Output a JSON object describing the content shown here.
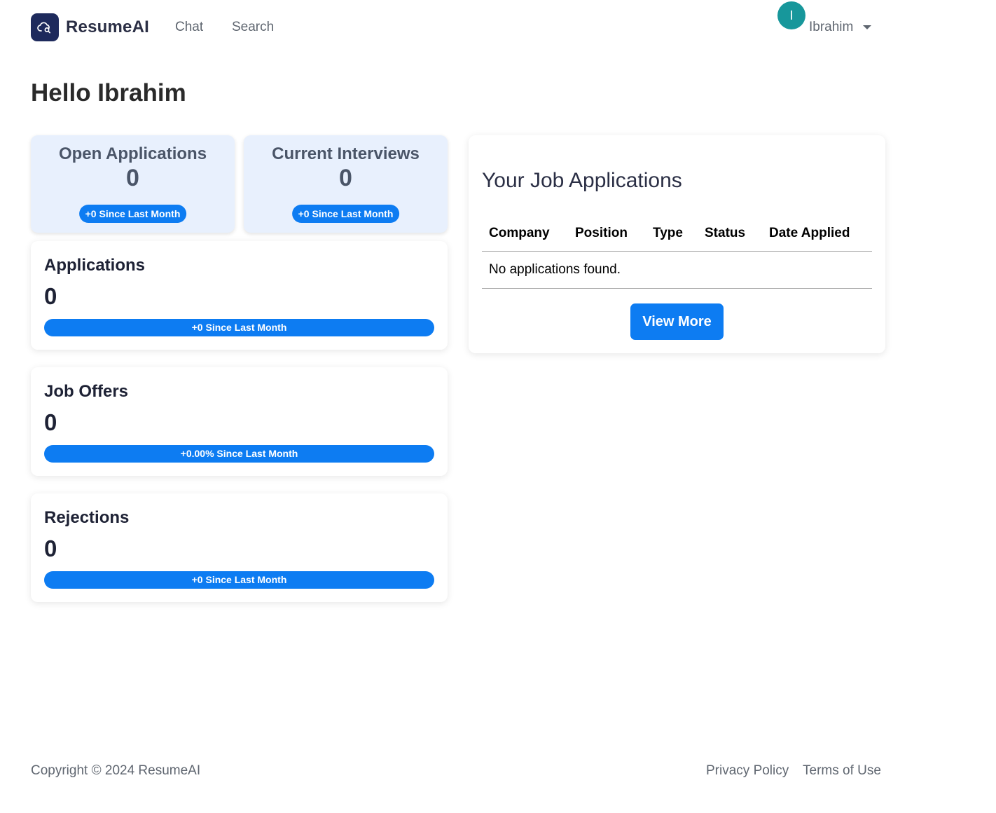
{
  "brand": {
    "name": "ResumeAI",
    "logo_icon": "cloud-search-icon",
    "logo_color": "#1e2a5c"
  },
  "nav": {
    "chat": "Chat",
    "search": "Search"
  },
  "user": {
    "initial": "I",
    "name": "Ibrahim",
    "avatar_color": "#17979b"
  },
  "greeting": "Hello Ibrahim",
  "tiles": {
    "open_applications": {
      "title": "Open Applications",
      "value": "0",
      "badge": "+0 Since Last Month"
    },
    "current_interviews": {
      "title": "Current Interviews",
      "value": "0",
      "badge": "+0 Since Last Month"
    }
  },
  "metrics": {
    "applications": {
      "title": "Applications",
      "value": "0",
      "bar_label": "+0 Since Last Month"
    },
    "job_offers": {
      "title": "Job Offers",
      "value": "0",
      "bar_label": "+0.00% Since Last Month"
    },
    "rejections": {
      "title": "Rejections",
      "value": "0",
      "bar_label": "+0 Since Last Month"
    }
  },
  "job_applications": {
    "title": "Your Job Applications",
    "columns": [
      "Company",
      "Position",
      "Type",
      "Status",
      "Date Applied"
    ],
    "empty_message": "No applications found.",
    "view_more": "View More"
  },
  "footer": {
    "copyright": "Copyright © 2024 ResumeAI",
    "privacy": "Privacy Policy",
    "terms": "Terms of Use"
  },
  "colors": {
    "accent": "#0d7cf2",
    "tile_background": "#e8f0fd"
  }
}
